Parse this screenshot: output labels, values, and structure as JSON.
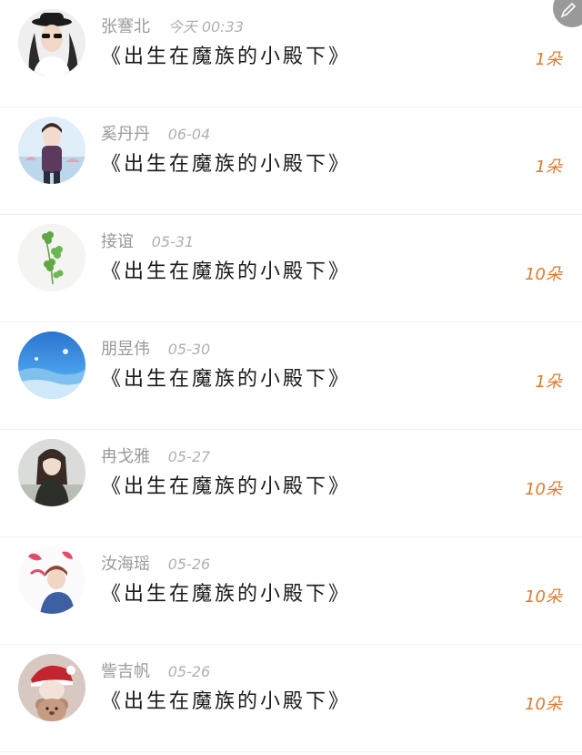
{
  "rows": [
    {
      "name": "张謇北",
      "date": "今天 00:33",
      "title": "《出生在魔族的小殿下》",
      "count": "1朵",
      "avatar_icon": "woman-in-hat-avatar"
    },
    {
      "name": "奚丹丹",
      "date": "06-04",
      "title": "《出生在魔族的小殿下》",
      "count": "1朵",
      "avatar_icon": "anime-boy-avatar"
    },
    {
      "name": "接谊",
      "date": "05-31",
      "title": "《出生在魔族的小殿下》",
      "count": "10朵",
      "avatar_icon": "clover-avatar"
    },
    {
      "name": "朋昱伟",
      "date": "05-30",
      "title": "《出生在魔族的小殿下》",
      "count": "1朵",
      "avatar_icon": "blue-sky-avatar"
    },
    {
      "name": "冉戈雅",
      "date": "05-27",
      "title": "《出生在魔族的小殿下》",
      "count": "10朵",
      "avatar_icon": "anime-girl-avatar"
    },
    {
      "name": "汝海瑶",
      "date": "05-26",
      "title": "《出生在魔族的小殿下》",
      "count": "10朵",
      "avatar_icon": "anime-character-avatar"
    },
    {
      "name": "訾吉帆",
      "date": "05-26",
      "title": "《出生在魔族的小殿下》",
      "count": "10朵",
      "avatar_icon": "teddy-bear-avatar"
    }
  ],
  "colors": {
    "count": "#e07a2c",
    "name": "#9a9a9a",
    "title": "#1a1a1a",
    "divider": "#f1f1f1"
  },
  "corner_icon": "edit-pencil-icon"
}
